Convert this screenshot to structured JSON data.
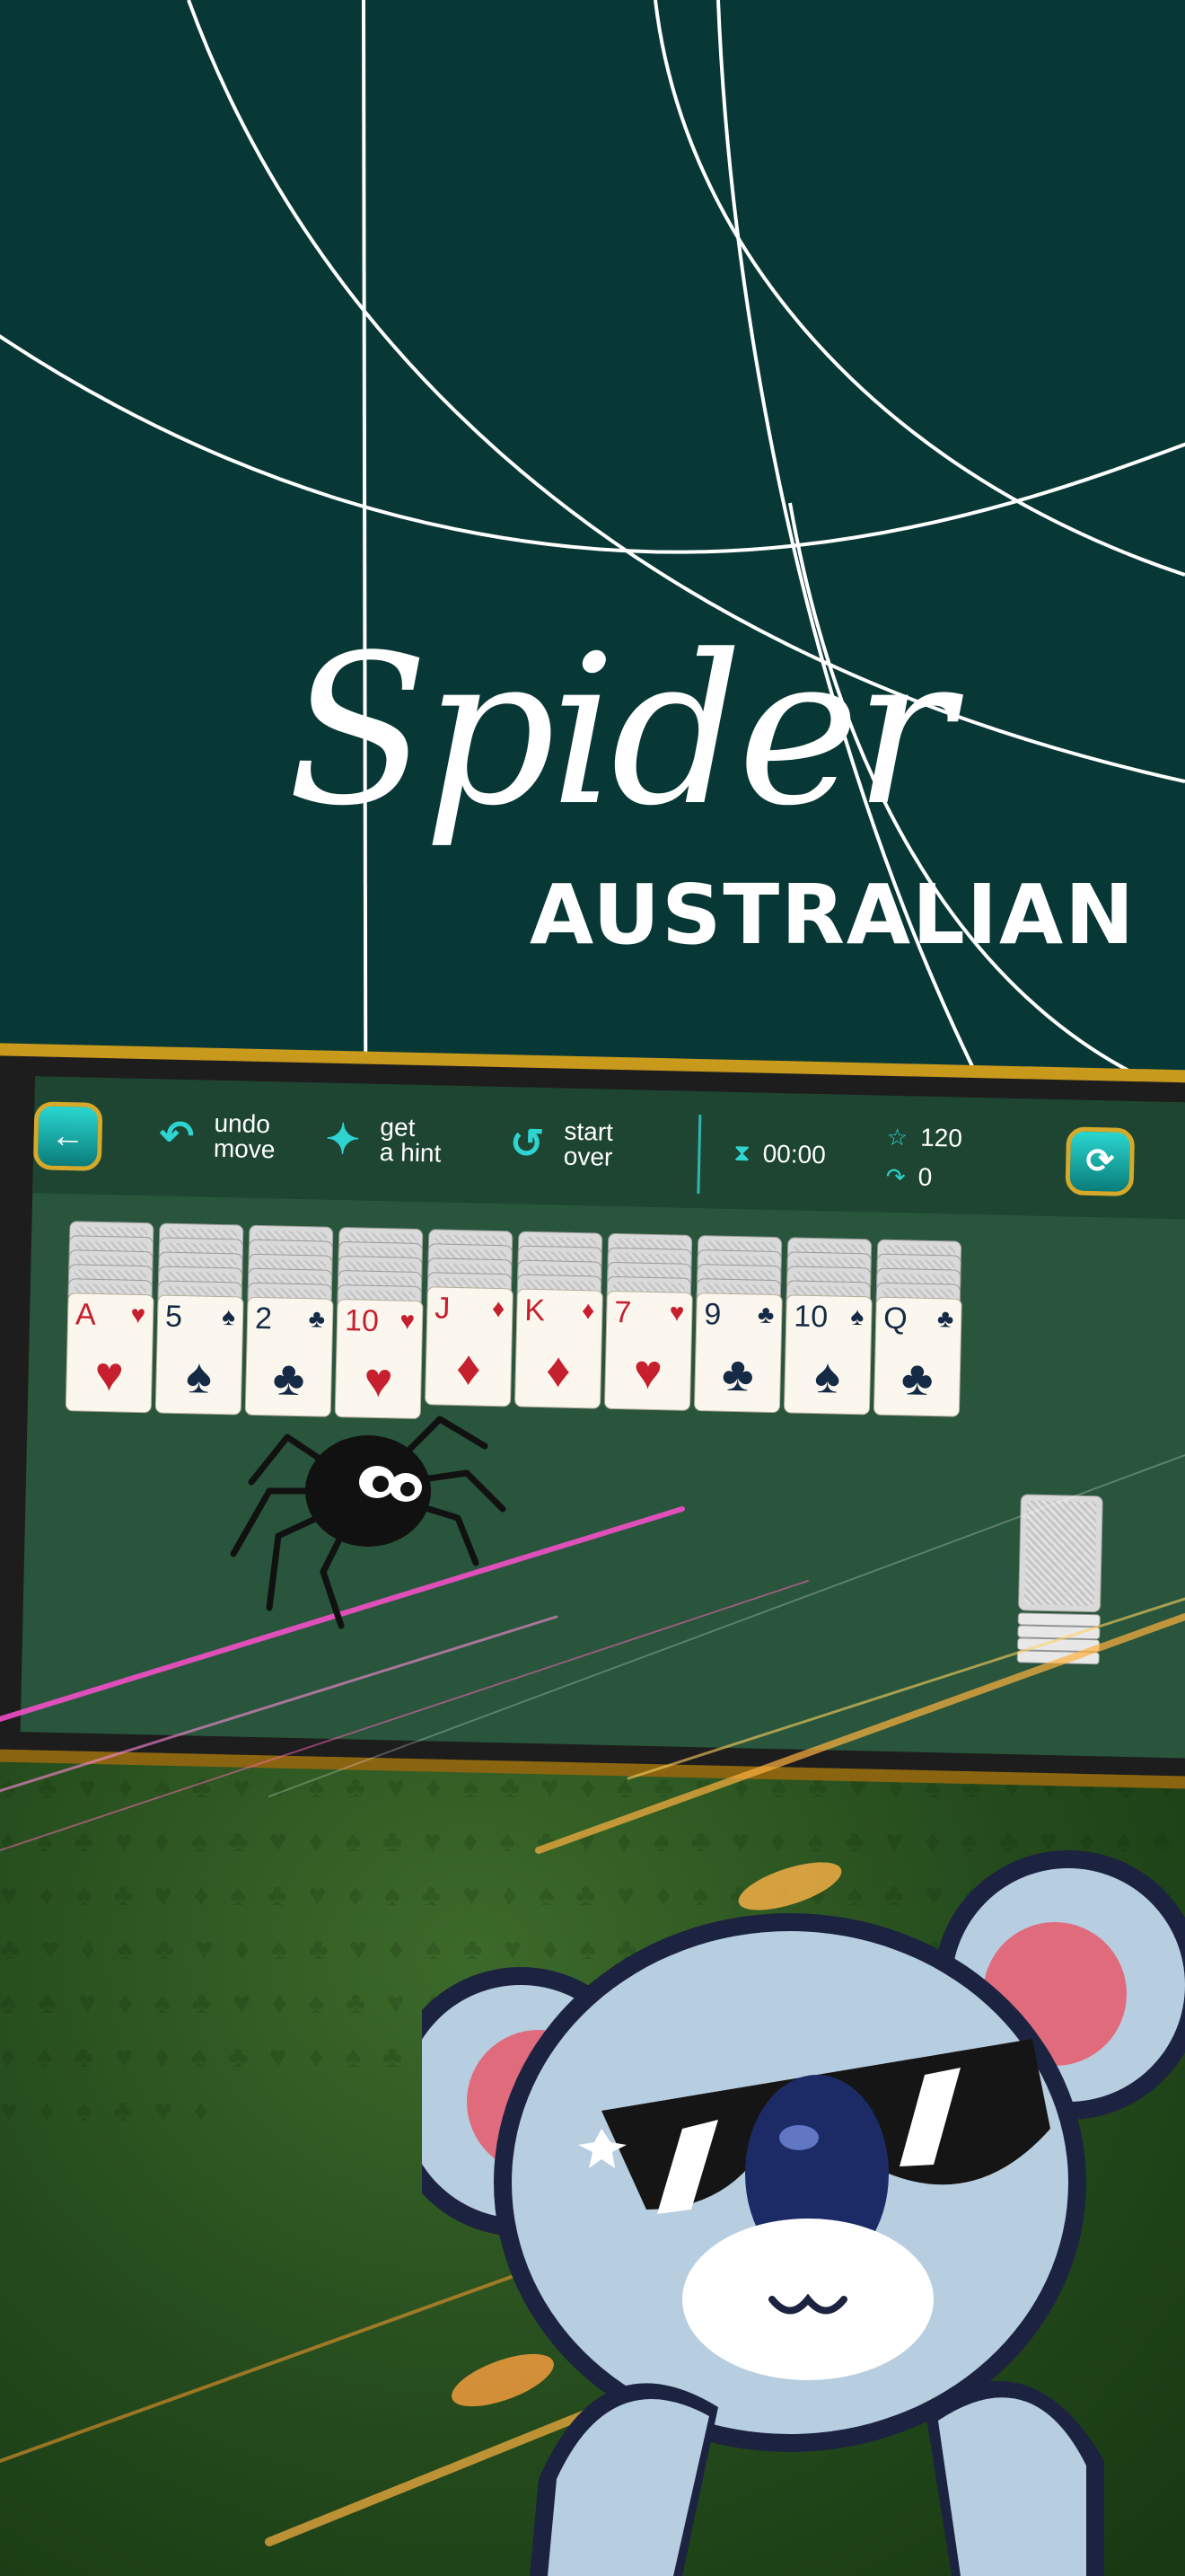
{
  "title": {
    "script": "Spider",
    "sub": "AUSTRALIAN"
  },
  "toolbar": {
    "back_icon": "arrow-left-icon",
    "undo_label": "undo\nmove",
    "undo_icon": "undo-arrow-icon",
    "hint_label": "get\na hint",
    "hint_icon": "magic-wand-icon",
    "start_over_label": "start\nover",
    "start_over_icon": "restart-arrow-icon",
    "timer": "00:00",
    "timer_icon": "hourglass-icon",
    "score": "120",
    "score_icon": "star-icon",
    "moves": "0",
    "moves_icon": "moves-arrow-icon",
    "refresh_icon": "refresh-icon"
  },
  "tableau": [
    {
      "rank": "A",
      "suit": "♥",
      "color": "red",
      "hidden": 5
    },
    {
      "rank": "5",
      "suit": "♠",
      "color": "blk",
      "hidden": 5
    },
    {
      "rank": "2",
      "suit": "♣",
      "color": "blk",
      "hidden": 5
    },
    {
      "rank": "10",
      "suit": "♥",
      "color": "red",
      "hidden": 5
    },
    {
      "rank": "J",
      "suit": "♦",
      "color": "red",
      "hidden": 4
    },
    {
      "rank": "K",
      "suit": "♦",
      "color": "red",
      "hidden": 4
    },
    {
      "rank": "7",
      "suit": "♥",
      "color": "red",
      "hidden": 4
    },
    {
      "rank": "9",
      "suit": "♣",
      "color": "blk",
      "hidden": 4
    },
    {
      "rank": "10",
      "suit": "♠",
      "color": "blk",
      "hidden": 4
    },
    {
      "rank": "Q",
      "suit": "♣",
      "color": "blk",
      "hidden": 4
    }
  ],
  "colors": {
    "accent": "#2fd3d0",
    "gold": "#d6a92a",
    "felt": "#28553b",
    "background": "#083835"
  }
}
